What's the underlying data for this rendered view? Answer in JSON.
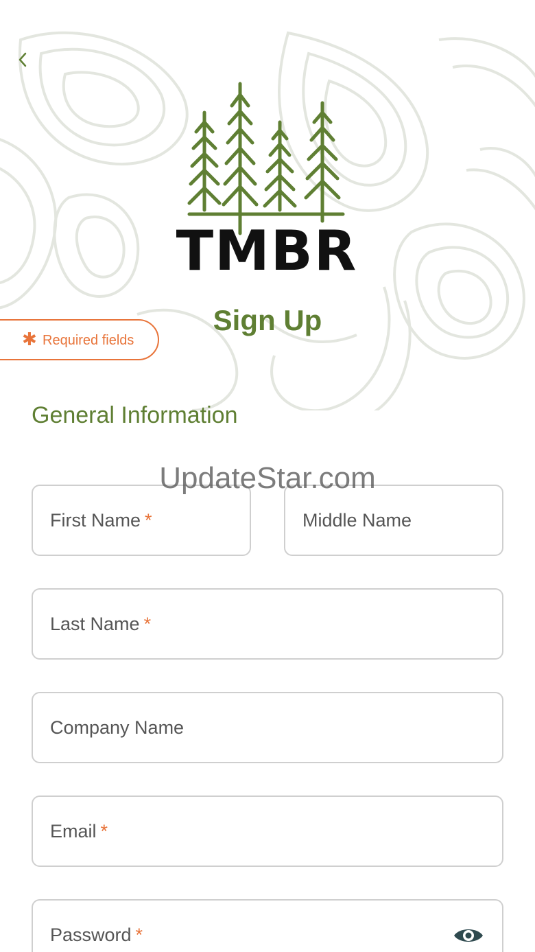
{
  "brand": {
    "logo_text": "TMBR",
    "tree_color": "#5f7f33"
  },
  "header": {
    "back_icon": "chevron-left-icon",
    "title": "Sign Up"
  },
  "badge": {
    "icon": "asterisk-icon",
    "label": "Required fields",
    "color": "#e8743a"
  },
  "section": {
    "title": "General Information"
  },
  "watermark": "UpdateStar.com",
  "form": {
    "required_mark": "*",
    "first_name": {
      "placeholder": "First Name"
    },
    "middle_name": {
      "placeholder": "Middle Name"
    },
    "last_name": {
      "placeholder": "Last Name"
    },
    "company_name": {
      "placeholder": "Company Name"
    },
    "email": {
      "placeholder": "Email"
    },
    "password": {
      "placeholder": "Password",
      "toggle_icon": "eye-icon"
    }
  },
  "colors": {
    "accent": "#5f7f33",
    "required": "#e8743a",
    "border": "#cfcfcf",
    "wordmark": "#111111"
  }
}
